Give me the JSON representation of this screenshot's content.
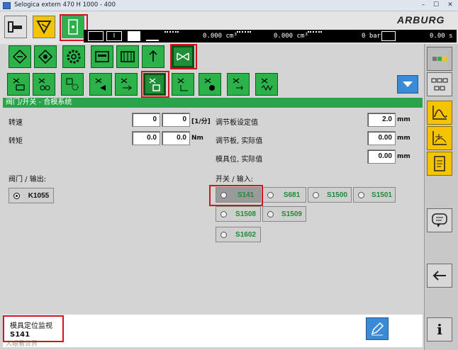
{
  "window": {
    "title": "Selogica extern  470 H  1000 - 400"
  },
  "brand": {
    "logo": "ARBURG"
  },
  "status": {
    "value1": "0.000",
    "unit1": "cm³",
    "value2": "0.000",
    "unit2": "cm³",
    "value3": "0",
    "unit3": "bar",
    "value4": "0.00",
    "unit4": "s"
  },
  "header": {
    "title": "阀门/开关 - 合模系统"
  },
  "params": {
    "speed_label": "转速",
    "speed_val1": "0",
    "speed_val2": "0",
    "speed_unit": "[1/分]",
    "torque_label": "转矩",
    "torque_val1": "0.0",
    "torque_val2": "0.0",
    "torque_unit": "Nm",
    "plate_set_label": "调节板设定值",
    "plate_set_val": "2.0",
    "plate_set_unit": "mm",
    "plate_act_label": "调节板, 实际值",
    "plate_act_val": "0.00",
    "plate_act_unit": "mm",
    "mold_act_label": "模具位, 实际值",
    "mold_act_val": "0.00",
    "mold_act_unit": "mm"
  },
  "outputs": {
    "title": "阀门 / 输出:",
    "items": [
      {
        "label": "K1055"
      }
    ]
  },
  "inputs": {
    "title": "开关 / 输入:",
    "items": [
      {
        "label": "S141"
      },
      {
        "label": "S681"
      },
      {
        "label": "S1500"
      },
      {
        "label": "S1501"
      },
      {
        "label": "S1508"
      },
      {
        "label": "S1509"
      },
      {
        "label": "S1602"
      }
    ]
  },
  "footer": {
    "title": "模具定位监视",
    "value": "S141",
    "watermark": "人眼看世界"
  },
  "colors": {
    "green": "#2bb34a",
    "yellow": "#f5c400",
    "highlight": "#d3141e",
    "blue": "#3a8ad6"
  },
  "icons": [
    "machine-icon",
    "funnel-warning-icon",
    "mold-icon",
    "valve-icon",
    "gear-icon",
    "menu-down-icon",
    "help-balloon-icon",
    "back-arrow-icon",
    "info-icon",
    "edit-icon"
  ]
}
